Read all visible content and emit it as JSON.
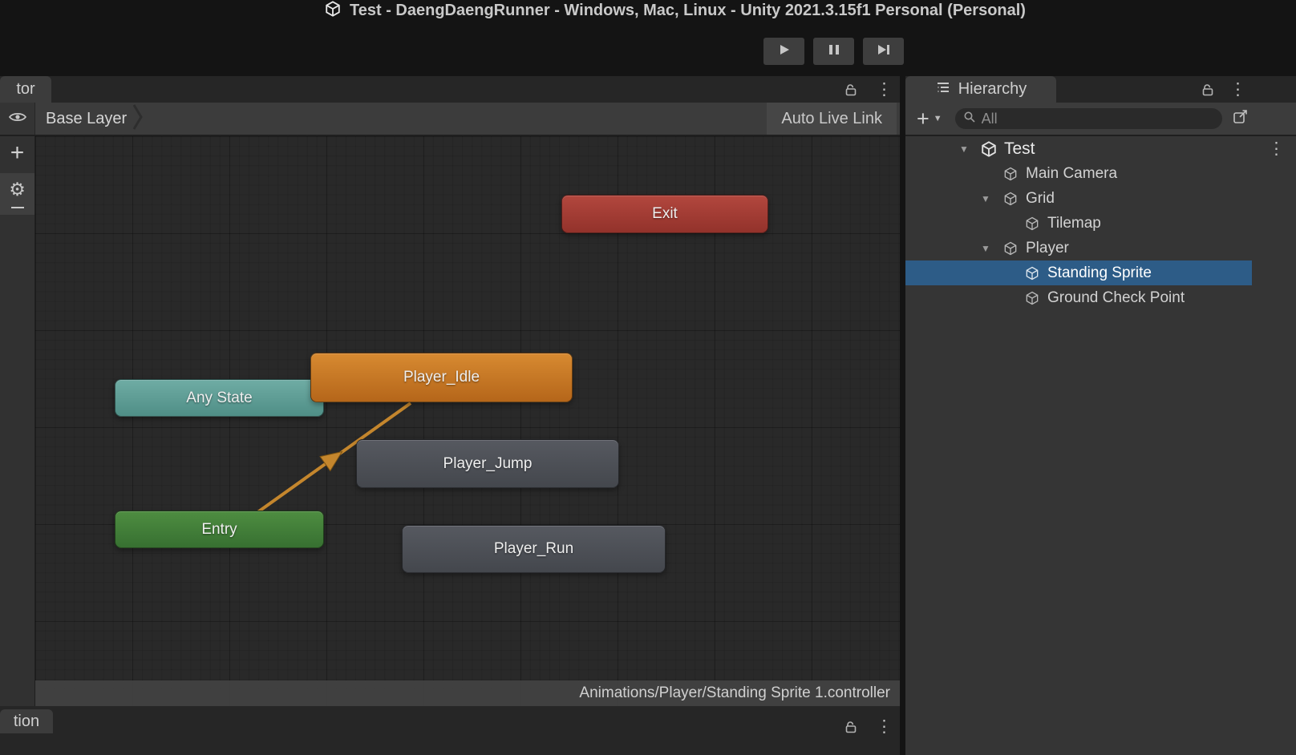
{
  "title_bar": {
    "title": "Test - DaengDaengRunner - Windows, Mac, Linux - Unity 2021.3.15f1 Personal (Personal)"
  },
  "play_controls": {
    "buttons": [
      "play-icon",
      "pause-icon",
      "step-forward-icon"
    ]
  },
  "animator_panel": {
    "tab_label": "tor",
    "breadcrumb": "Base Layer",
    "auto_live_link_label": "Auto Live Link",
    "status_path": "Animations/Player/Standing Sprite 1.controller",
    "nodes": [
      {
        "label": "Exit",
        "color": "#A53B33"
      },
      {
        "label": "Player_Idle",
        "color": "#C97A26"
      },
      {
        "label": "Any State",
        "color": "#5FA099"
      },
      {
        "label": "Player_Jump",
        "color": "#4D5057"
      },
      {
        "label": "Entry",
        "color": "#46853B"
      },
      {
        "label": "Player_Run",
        "color": "#4D5057"
      }
    ],
    "transitions": [
      {
        "from": "Entry",
        "to": "Player_Idle",
        "color": "#C4862D"
      }
    ]
  },
  "bottom_panel": {
    "tab_label": "tion"
  },
  "hierarchy_panel": {
    "tab_label": "Hierarchy",
    "search": {
      "placeholder": "All"
    },
    "tree": [
      {
        "label": "Test",
        "depth": 0,
        "expanded": true,
        "icon": "unity-scene-icon",
        "selected": false
      },
      {
        "label": "Main Camera",
        "depth": 1,
        "expanded": false,
        "icon": "gameobject-cube-icon",
        "selected": false
      },
      {
        "label": "Grid",
        "depth": 1,
        "expanded": true,
        "icon": "gameobject-cube-icon",
        "selected": false
      },
      {
        "label": "Tilemap",
        "depth": 2,
        "expanded": false,
        "icon": "gameobject-cube-icon",
        "selected": false
      },
      {
        "label": "Player",
        "depth": 1,
        "expanded": true,
        "icon": "gameobject-cube-icon",
        "selected": false
      },
      {
        "label": "Standing Sprite",
        "depth": 2,
        "expanded": false,
        "icon": "gameobject-cube-icon",
        "selected": true
      },
      {
        "label": "Ground Check Point",
        "depth": 2,
        "expanded": false,
        "icon": "gameobject-cube-icon",
        "selected": false
      }
    ]
  },
  "colors": {
    "selection_blue": "#2D5C87",
    "titlebar_bg": "#141414",
    "panel_header_bg": "#3C3C3C",
    "graph_bg": "#292929",
    "transition_arrow": "#C4862D"
  },
  "icons": [
    "unity-logo-icon",
    "play-icon",
    "pause-icon",
    "step-forward-icon",
    "eye-icon",
    "lock-icon",
    "kebab-menu-icon",
    "plus-icon",
    "gear-icon",
    "hierarchy-list-icon",
    "search-icon",
    "dropdown-caret-icon",
    "expand-window-icon",
    "foldout-arrow-icon",
    "gameobject-cube-icon",
    "unity-scene-icon",
    "breadcrumb-chevron-icon"
  ]
}
